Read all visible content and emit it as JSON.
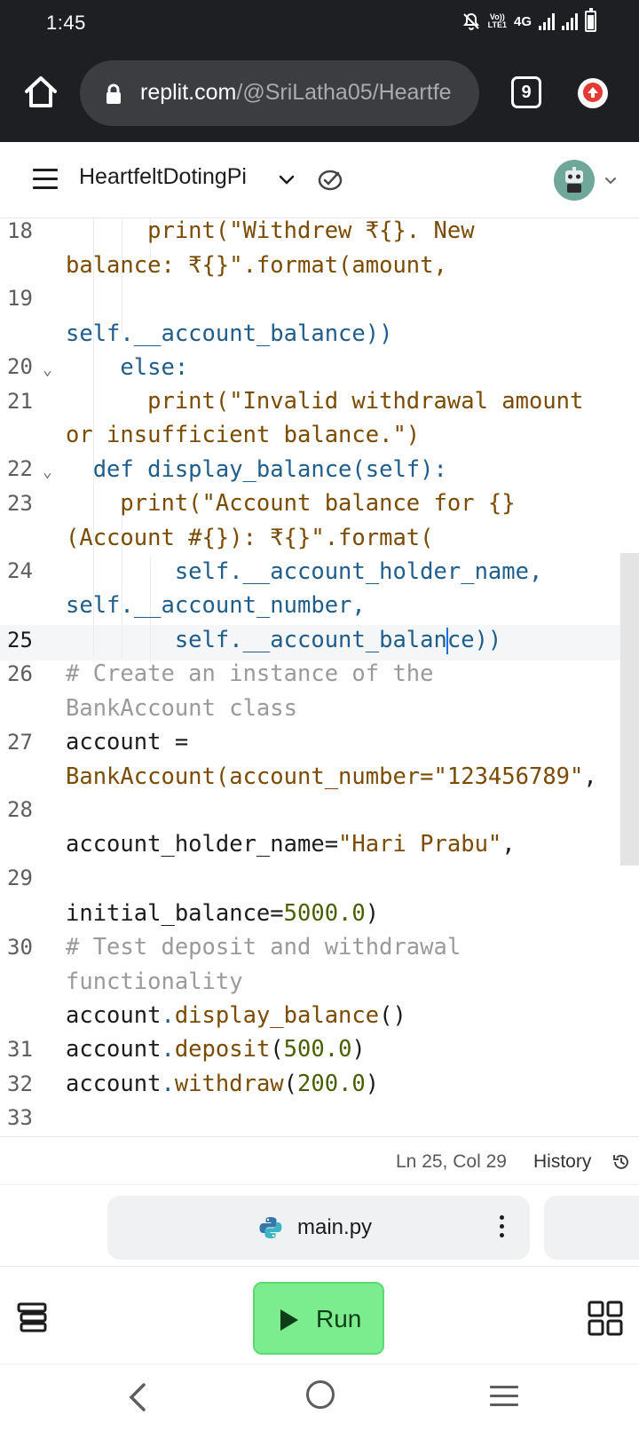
{
  "status_bar": {
    "time": "1:45",
    "network_label": "4G",
    "volte_label": "Vo)) LTE1"
  },
  "browser": {
    "url_domain": "replit.com",
    "url_path": "/@SriLatha05/Heartfe",
    "tab_count": "9"
  },
  "header": {
    "repl_name": "HeartfeltDotingPi"
  },
  "editor": {
    "active_line": "25",
    "line_numbers": [
      "18",
      "19",
      "20",
      "21",
      "22",
      "23",
      "24",
      "25",
      "26",
      "27",
      "28",
      "29",
      "30",
      "31",
      "32",
      "33"
    ],
    "lines": {
      "l18a": "      print(\"Withdrew ₹{}. New",
      "l18b": "balance: ₹{}\".format(amount,",
      "l19b": "self.__account_balance))",
      "l20": "    else:",
      "l21a": "      print(\"Invalid withdrawal amount",
      "l21b": "or insufficient balance.\")",
      "l22": "  def display_balance(self):",
      "l23a": "    print(\"Account balance for {}",
      "l23b": "(Account #{}): ₹{}\".format(",
      "l24a": "        self.__account_holder_name,",
      "l24b": "self.__account_number,",
      "l25_pre": "        self.__account_balan",
      "l25_post": "ce))",
      "l26a": "# Create an instance of the",
      "l26b": "BankAccount class",
      "l27a": "account =",
      "l27b_pre": "BankAccount(account_number=",
      "l27b_str": "\"123456789\"",
      "l27b_post": ",",
      "l28_pre": "account_holder_name=",
      "l28_str": "\"Hari Prabu\"",
      "l28_post": ",",
      "l29_pre": "initial_balance=",
      "l29_num": "5000.0",
      "l29_post": ")",
      "l30a": "# Test deposit and withdrawal",
      "l30b": "functionality",
      "l31_obj": "account",
      "l31_fn": "display_balance",
      "l31_post": "()",
      "l32_obj": "account",
      "l32_fn": "deposit",
      "l32_num": "500.0",
      "l33_obj": "account",
      "l33_fn": "withdraw",
      "l33_num": "200.0"
    }
  },
  "status_strip": {
    "cursor_position": "Ln 25, Col 29",
    "history_label": "History"
  },
  "file_tabs": {
    "active_file": "main.py"
  },
  "action_bar": {
    "run_label": "Run"
  },
  "colors": {
    "run_button": "#7ced8e",
    "keyword": "#1f5d8c",
    "string": "#7a4b00",
    "number": "#485f00",
    "comment": "#9a9a9a",
    "cursor": "#1d6fe0"
  }
}
